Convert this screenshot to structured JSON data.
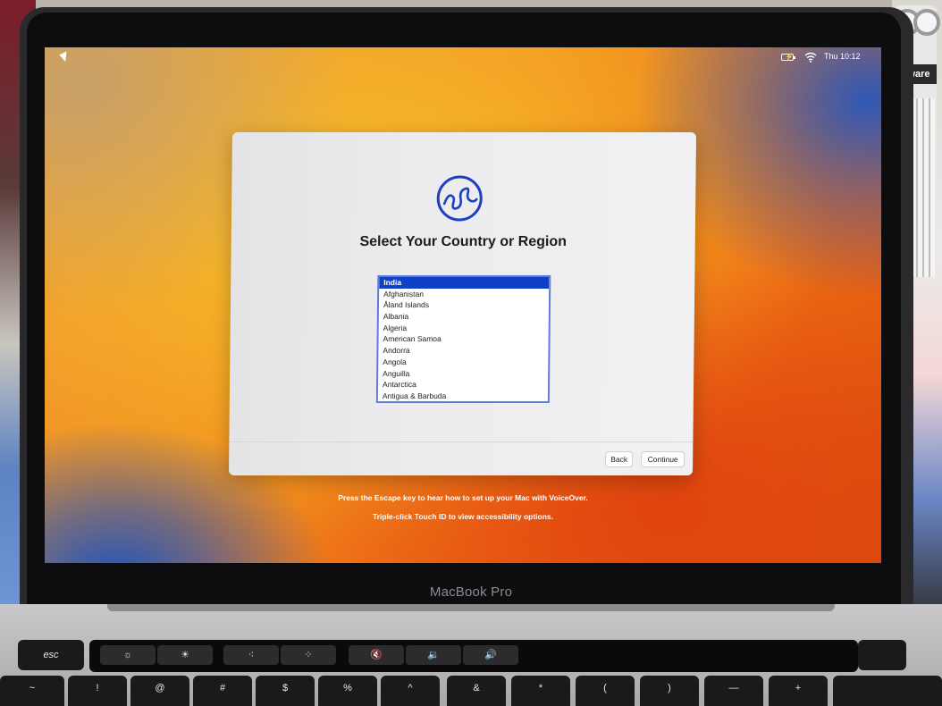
{
  "menubar": {
    "battery_icon": "battery-charging-icon",
    "wifi_icon": "wifi-icon",
    "clock": "Thu 10:12"
  },
  "dialog": {
    "icon": "globe-icon",
    "title": "Select Your Country or Region",
    "countries": [
      "India",
      "Afghanistan",
      "Åland Islands",
      "Albania",
      "Algeria",
      "American Samoa",
      "Andorra",
      "Angola",
      "Anguilla",
      "Antarctica",
      "Antigua & Barbuda"
    ],
    "selected": "India",
    "back_label": "Back",
    "continue_label": "Continue"
  },
  "footer": {
    "voiceover_hint": "Press the Escape key to hear how to set up your Mac with VoiceOver.",
    "accessibility_hint": "Triple-click Touch ID to view accessibility options."
  },
  "hardware": {
    "laptop_label": "MacBook Pro",
    "speaker_brand": "ndware",
    "esc_label": "esc",
    "touchbar_icons": [
      "brightness-down-icon",
      "brightness-up-icon",
      "keyboard-light-down-icon",
      "keyboard-light-up-icon",
      "mute-icon",
      "volume-down-icon",
      "volume-up-icon"
    ],
    "keys": [
      "~",
      "!",
      "@",
      "#",
      "$",
      "%",
      "^",
      "&",
      "*",
      "(",
      ")",
      "—",
      "+"
    ]
  },
  "colors": {
    "selection": "#1040c8",
    "globe_stroke": "#1d3fc2"
  }
}
